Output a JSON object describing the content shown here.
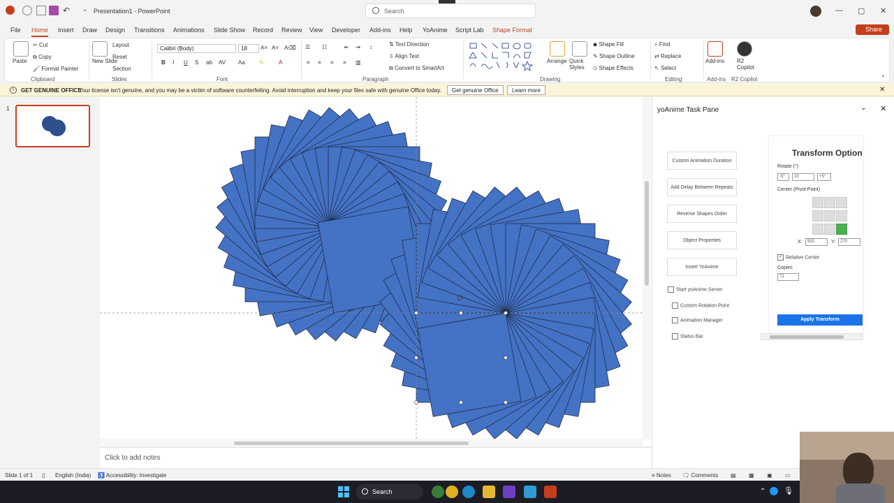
{
  "window": {
    "title": "Presentation1  -  PowerPoint",
    "search_placeholder": "Search"
  },
  "menu": {
    "items": [
      "File",
      "Home",
      "Insert",
      "Draw",
      "Design",
      "Transitions",
      "Animations",
      "Slide Show",
      "Record",
      "Review",
      "View",
      "Developer",
      "Add-ins",
      "Help",
      "YoAnime",
      "Script Lab",
      "Shape Format"
    ],
    "active": "Home",
    "share": "Share"
  },
  "ribbon": {
    "clipboard": {
      "paste": "Paste",
      "cut": "Cut",
      "copy": "Copy",
      "format_painter": "Format Painter",
      "group": "Clipboard"
    },
    "slides": {
      "new_slide": "New Slide",
      "layout": "Layout",
      "reset": "Reset",
      "section": "Section",
      "group": "Slides"
    },
    "font": {
      "name": "Calibri (Body)",
      "size": "18",
      "group": "Font"
    },
    "paragraph": {
      "text_direction": "Text Direction",
      "align_text": "Align Text",
      "convert_smartart": "Convert to SmartArt",
      "group": "Paragraph"
    },
    "drawing": {
      "arrange": "Arrange",
      "quick_styles": "Quick Styles",
      "shape_fill": "Shape Fill",
      "shape_outline": "Shape Outline",
      "shape_effects": "Shape Effects",
      "group": "Drawing"
    },
    "editing": {
      "find": "Find",
      "replace": "Replace",
      "select": "Select",
      "group": "Editing"
    },
    "addins": {
      "label": "Add-ins",
      "group": "Add-ins"
    },
    "copilot": {
      "label": "R2 Copilot",
      "group": "R2 Copilot"
    }
  },
  "infobar": {
    "label": "GET GENUINE OFFICE",
    "message": "Your license isn't genuine, and you may be a victim of software counterfeiting. Avoid interruption and keep your files safe with genuine Office today.",
    "btn_genuine": "Get genuine Office",
    "btn_learn": "Learn more"
  },
  "slides_pane": {
    "slide_number": "1"
  },
  "canvas": {
    "shape_color": "#4472c4",
    "shape_outline": "#1f2d4a"
  },
  "notes": {
    "placeholder": "Click to add notes"
  },
  "task_pane": {
    "title": "yoAnime Task Pane",
    "buttons": [
      "Custom Animation Duration",
      "Add Delay Between Repeats",
      "Reverse Shapes Order",
      "Object Properties",
      "Insert YoAnime"
    ],
    "checkboxes": [
      "Start yoAnime Server",
      "Custom Rotation Point",
      "Animation Manager",
      "Status Bar"
    ],
    "transform": {
      "title": "Transform Option",
      "rotate_label": "Rotate (°)",
      "rotate_values": [
        "-5°",
        "10",
        "+5°"
      ],
      "center_label": "Center (Pivot Point)",
      "x_label": "X:",
      "x_value": "502",
      "y_label": "Y:",
      "y_value": "270",
      "relative_center": "Relative Center",
      "copies_label": "Copies",
      "copies_value": "72",
      "apply": "Apply Transform"
    }
  },
  "status": {
    "slide": "Slide 1 of 1",
    "language": "English (India)",
    "accessibility": "Accessibility: Investigate",
    "notes": "Notes",
    "comments": "Comments"
  },
  "taskbar": {
    "search": "Search"
  },
  "colors": {
    "accent": "#b7472a",
    "share": "#c43e1c",
    "apply": "#1a73e8",
    "pivot_selected": "#4caf50"
  }
}
